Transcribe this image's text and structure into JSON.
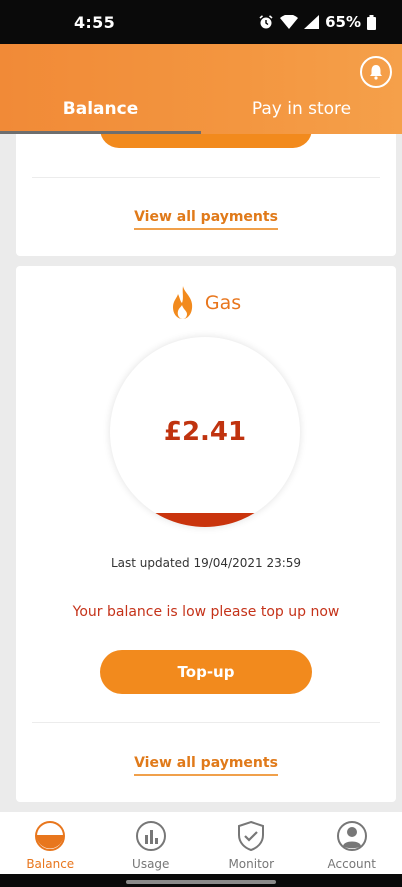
{
  "status_bar": {
    "time": "4:55",
    "battery": "65%"
  },
  "header": {
    "tabs": [
      {
        "label": "Balance",
        "active": true
      },
      {
        "label": "Pay in store",
        "active": false
      }
    ]
  },
  "payments_card": {
    "link_label": "View all payments"
  },
  "gas_card": {
    "title": "Gas",
    "balance": "£2.41",
    "last_updated": "Last updated 19/04/2021 23:59",
    "warning": "Your balance is low please top up now",
    "topup_label": "Top-up",
    "link_label": "View all payments"
  },
  "bottom_nav": {
    "items": [
      {
        "label": "Balance",
        "icon": "balance-gauge-icon",
        "active": true
      },
      {
        "label": "Usage",
        "icon": "usage-chart-icon",
        "active": false
      },
      {
        "label": "Monitor",
        "icon": "monitor-shield-icon",
        "active": false
      },
      {
        "label": "Account",
        "icon": "account-person-icon",
        "active": false
      }
    ]
  },
  "colors": {
    "accent": "#f28a1d",
    "warning": "#c5331a",
    "header": "#f39640"
  }
}
